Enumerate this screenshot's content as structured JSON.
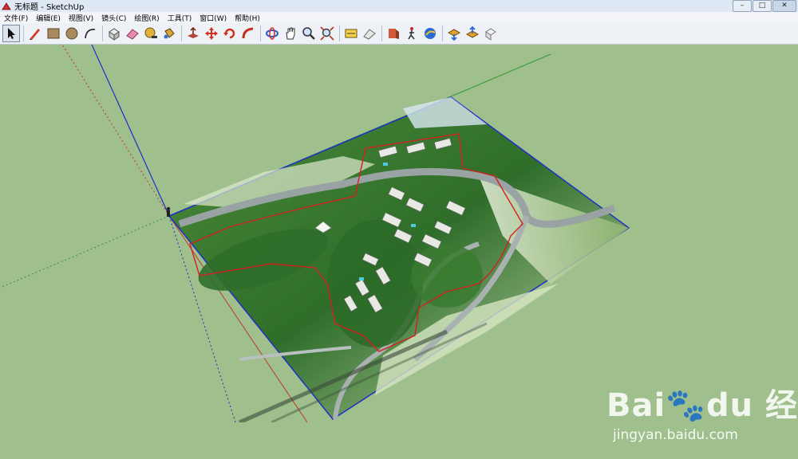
{
  "window": {
    "title": "无标题 - SketchUp",
    "minimize": "–",
    "maximize": "□",
    "close": "✕"
  },
  "menu": [
    "文件(F)",
    "编辑(E)",
    "视图(V)",
    "镜头(C)",
    "绘图(R)",
    "工具(T)",
    "窗口(W)",
    "帮助(H)"
  ],
  "toolbar": {
    "tools": [
      "select-icon",
      "pencil-line-icon",
      "rectangle-icon",
      "circle-icon",
      "arc-icon",
      "make-component-icon",
      "eraser-icon",
      "tape-measure-icon",
      "paint-bucket-icon",
      "push-pull-icon",
      "move-icon",
      "rotate-icon",
      "follow-me-icon",
      "orbit-icon",
      "pan-icon",
      "zoom-icon",
      "zoom-extents-icon",
      "dimension-icon",
      "protractor-icon",
      "section-plane-icon",
      "walk-icon",
      "position-camera-icon",
      "look-around-icon",
      "get-models-icon",
      "share-model-icon",
      "components-icon"
    ]
  },
  "watermark": {
    "logo": "Bai🐾du 经验",
    "url": "jingyan.baidu.com"
  },
  "colors": {
    "ground": "#9fbf8d",
    "axis_red": "#c0392b",
    "axis_green": "#2e9b2e",
    "axis_blue": "#1f2fc6",
    "boundary": "#d42020"
  }
}
